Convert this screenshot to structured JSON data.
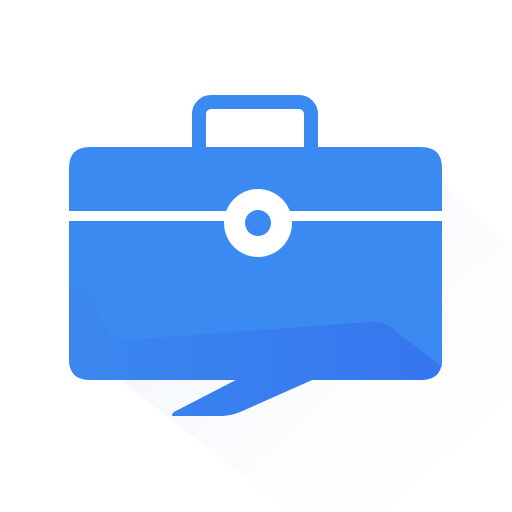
{
  "app_icon": {
    "icon": "briefcase-chat-icon",
    "colors": {
      "background": "#ffffff",
      "body": "#3a8af2",
      "body_light": "#3f94f7",
      "body_shade": "#3378f0",
      "stripe": "#ffffff",
      "clasp_dot": "#3a8af2",
      "shadow": "#eef3fb"
    }
  }
}
